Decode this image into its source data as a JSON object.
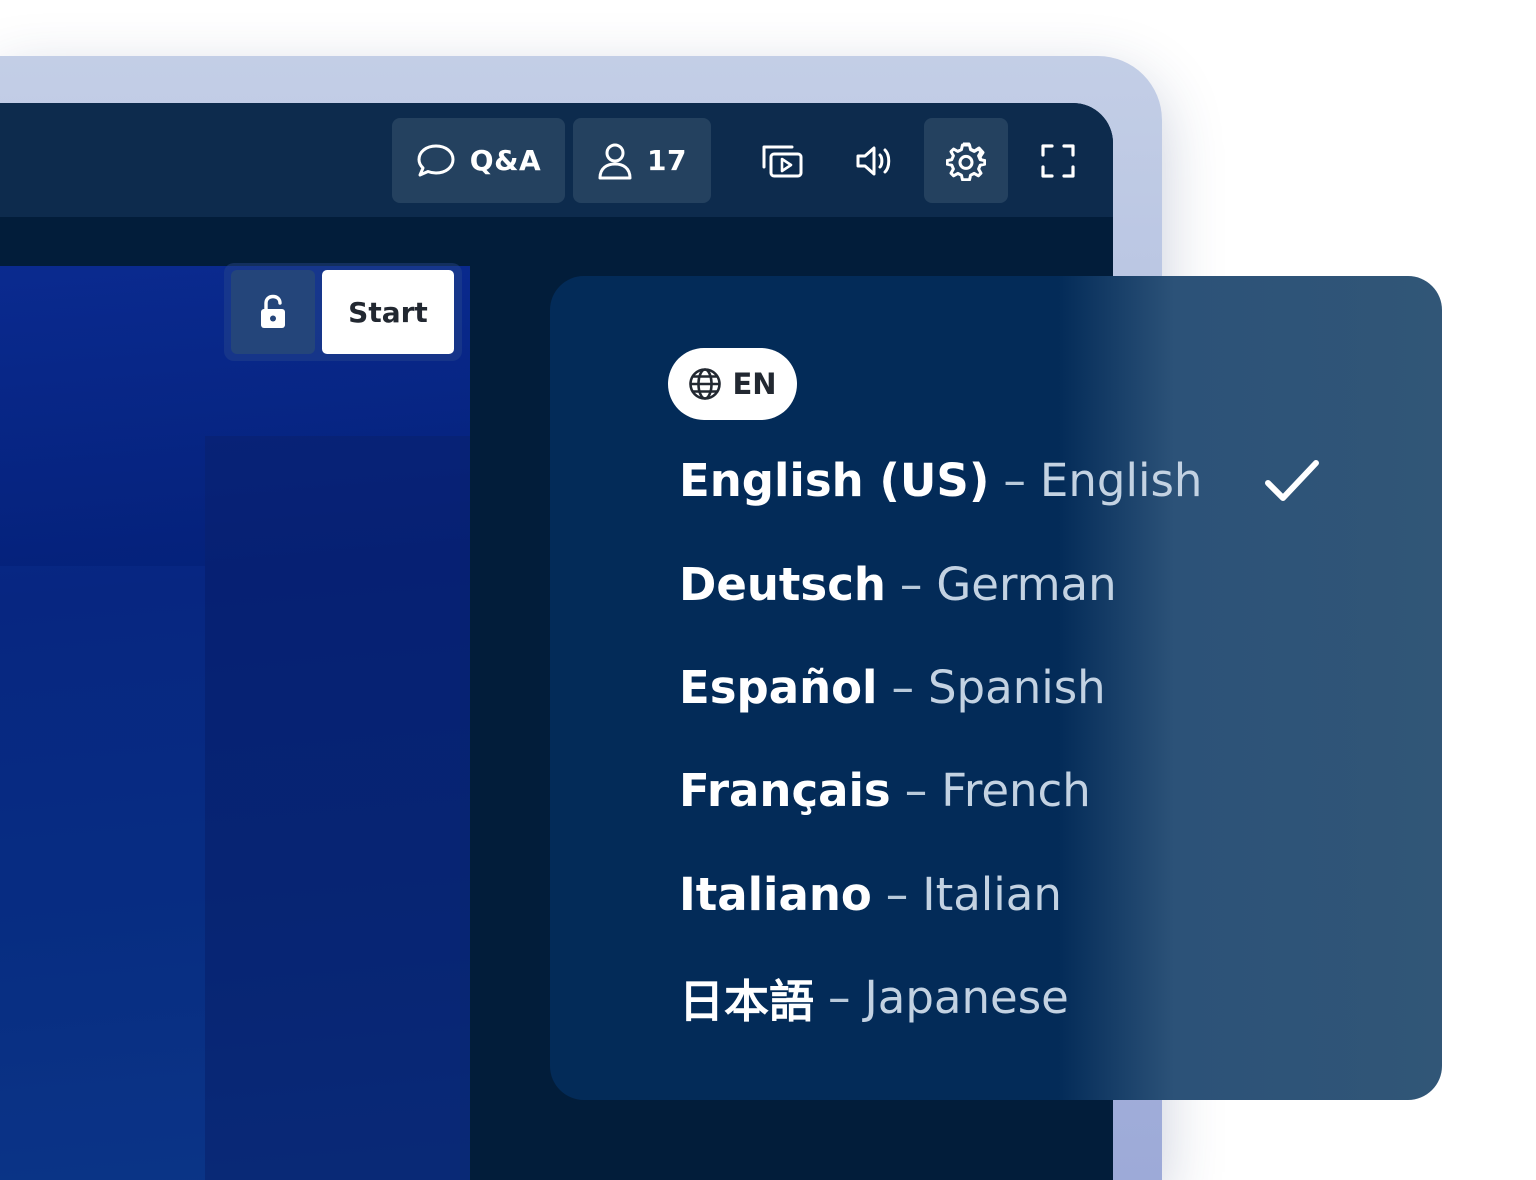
{
  "toolbar": {
    "qa_label": "Q&A",
    "participants_count": "17"
  },
  "slide": {
    "start_label": "Start"
  },
  "language_menu": {
    "current_code": "EN",
    "separator": "–",
    "languages": [
      {
        "native": "English (US)",
        "english": "English",
        "selected": true
      },
      {
        "native": "Deutsch",
        "english": "German",
        "selected": false
      },
      {
        "native": "Español",
        "english": "Spanish",
        "selected": false
      },
      {
        "native": "Français",
        "english": "French",
        "selected": false
      },
      {
        "native": "Italiano",
        "english": "Italian",
        "selected": false
      },
      {
        "native": "日本語",
        "english": "Japanese",
        "selected": false
      }
    ]
  },
  "colors": {
    "toolbar_bg": "#0d2b4d",
    "screen_bg": "#021d3a",
    "panel_bg": "#032b58",
    "slide_bg": "#04217a",
    "text_primary": "#ffffff",
    "text_secondary": "#c3d2e2"
  },
  "icons": {
    "qa": "chat-bubble-icon",
    "participants": "user-icon",
    "screen_share": "screen-share-icon",
    "audio": "speaker-icon",
    "settings": "gear-icon",
    "fullscreen": "fullscreen-icon",
    "lock": "unlock-icon",
    "language": "globe-icon",
    "selected": "check-icon"
  }
}
